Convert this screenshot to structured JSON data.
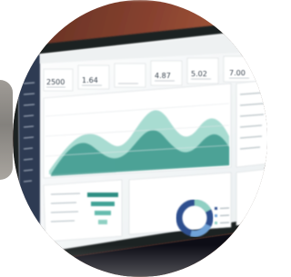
{
  "photo": {
    "subject": "laptop-displaying-analytics-dashboard",
    "style": "blurred-circular-crop",
    "colors": {
      "wood": "#7a3c2a",
      "wood_light": "#a45a3d",
      "bezel": "#1e2226",
      "screen": "#f7f8f8",
      "sidebar": "#2e3b52",
      "teal_dark": "#2f8f83",
      "teal_light": "#8fd0c3",
      "donut_blue": "#2e4f8f",
      "keyboard": "#0f1113"
    }
  },
  "dashboard": {
    "stat_values": [
      "2500",
      "1.64",
      "",
      "4.87",
      "5.02",
      "7.00"
    ]
  }
}
